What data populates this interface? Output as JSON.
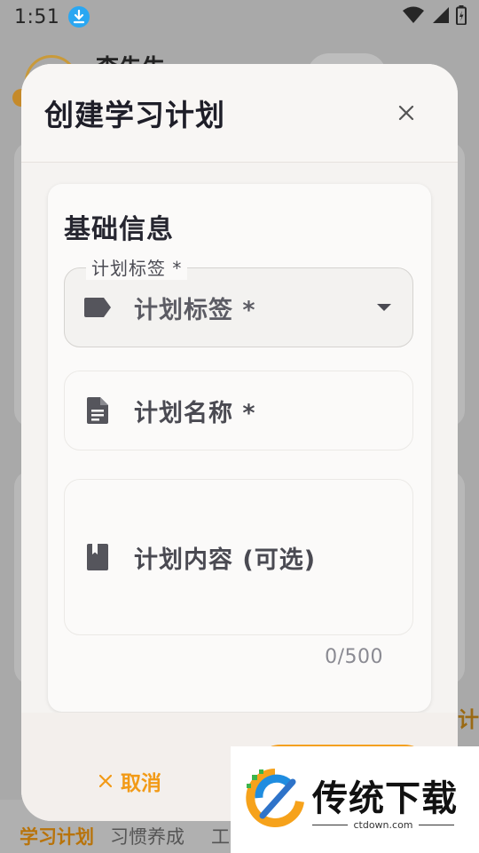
{
  "status_bar": {
    "time": "1:51"
  },
  "background": {
    "header_title": "李先生",
    "right_text": "计",
    "tabs": [
      {
        "label": "学习计划"
      },
      {
        "label": "习惯养成"
      },
      {
        "label": "工"
      }
    ]
  },
  "dialog": {
    "title": "创建学习计划",
    "section_title": "基础信息",
    "fields": {
      "tag": {
        "label": "计划标签 *",
        "placeholder": "计划标签 *"
      },
      "name": {
        "placeholder": "计划名称 *"
      },
      "content": {
        "placeholder": "计划内容 (可选)",
        "counter": "0/500"
      }
    },
    "footer": {
      "cancel_label": "取消"
    }
  },
  "watermark": {
    "brand": "传统下载",
    "url": "ctdown.com"
  },
  "colors": {
    "accent": "#f29a16",
    "dim_overlay": "#a9a9a9",
    "dialog_bg": "#f5f3f1"
  },
  "icons": {
    "download": "download-icon",
    "wifi": "wifi-icon",
    "signal": "signal-icon",
    "battery": "battery-icon",
    "close": "close-icon",
    "tag": "tag-icon",
    "document": "document-icon",
    "book": "book-icon",
    "dropdown": "dropdown-arrow-icon",
    "cancel": "close-icon"
  }
}
